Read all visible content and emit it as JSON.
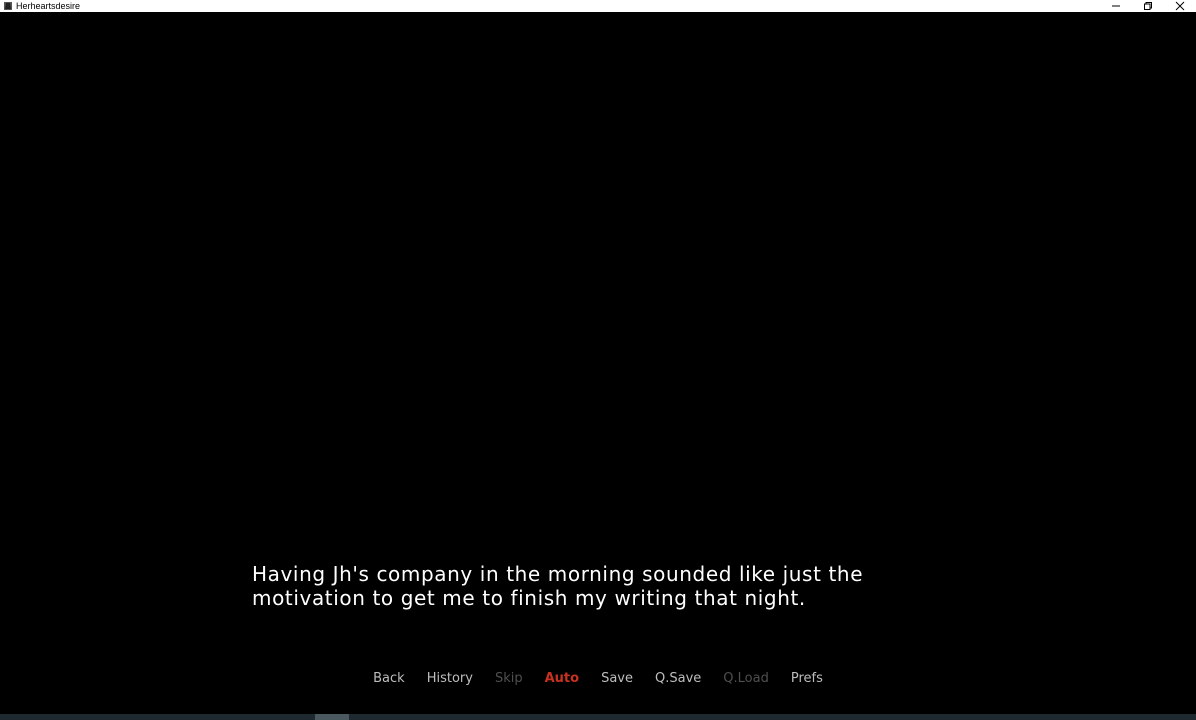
{
  "window": {
    "title": "Herheartsdesire",
    "app_icon": "app-icon",
    "controls": [
      "minimize-icon",
      "restore-icon",
      "close-icon"
    ]
  },
  "dialogue": {
    "line1": "Having Jh's company in the morning sounded like just the",
    "line2": "motivation to get me to finish my writing that night."
  },
  "quick_menu": {
    "back": "Back",
    "history": "History",
    "skip": "Skip",
    "auto": "Auto",
    "save": "Save",
    "qsave": "Q.Save",
    "qload": "Q.Load",
    "prefs": "Prefs"
  },
  "colors": {
    "background": "#000000",
    "dialogue_text": "#ffffff",
    "menu_text": "#bdbdbd",
    "menu_disabled": "#4f4f4f",
    "menu_active": "#c8311f"
  }
}
